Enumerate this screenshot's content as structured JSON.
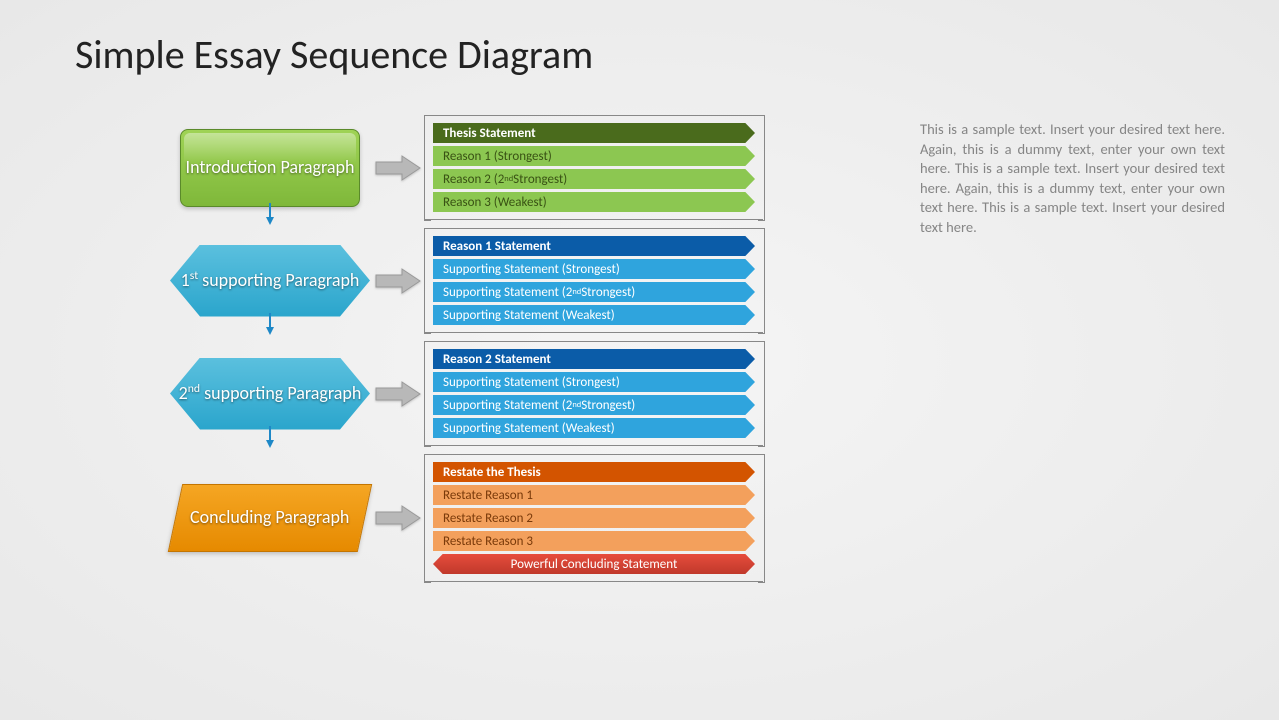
{
  "title": "Simple Essay Sequence Diagram",
  "shapes": {
    "intro": "Introduction Paragraph",
    "sup1": "1<sup>st</sup> supporting Paragraph",
    "sup2": "2<sup>nd</sup> supporting Paragraph",
    "concl": "Concluding Paragraph"
  },
  "panels": {
    "intro": {
      "head": "Thesis Statement",
      "items": [
        "Reason 1 (Strongest)",
        "Reason 2 (2<sup>nd</sup> Strongest)",
        "Reason 3 (Weakest)"
      ]
    },
    "sup1": {
      "head": "Reason 1 Statement",
      "items": [
        "Supporting Statement (Strongest)",
        "Supporting Statement (2<sup>nd</sup> Strongest)",
        "Supporting Statement (Weakest)"
      ]
    },
    "sup2": {
      "head": "Reason 2 Statement",
      "items": [
        "Supporting Statement (Strongest)",
        "Supporting Statement (2<sup>nd</sup> Strongest)",
        "Supporting Statement (Weakest)"
      ]
    },
    "concl": {
      "head": "Restate the Thesis",
      "items": [
        "Restate Reason 1",
        "Restate Reason 2",
        "Restate Reason 3"
      ],
      "final": "Powerful Concluding Statement"
    }
  },
  "sidetext": "This is a sample text. Insert your desired text here. Again, this is a dummy text, enter your own text here. This is a sample text. Insert your desired text here. Again, this is a dummy text, enter your own text here. This is a sample text. Insert your desired text here."
}
